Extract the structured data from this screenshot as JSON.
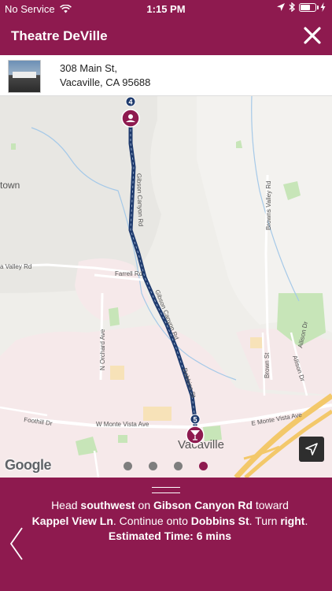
{
  "status_bar": {
    "carrier": "No Service",
    "time": "1:15 PM"
  },
  "header": {
    "title": "Theatre DeVille"
  },
  "location": {
    "address_line1": "308 Main St,",
    "address_line2": "Vacaville, CA 95688"
  },
  "map": {
    "labels": {
      "town_left": "town",
      "valley_rd": "a Valley Rd",
      "farrell_rd": "Farrell Rd",
      "n_orchard_ave": "N Orchard Ave",
      "browns_valley_rd": "Browns Valley Rd",
      "brown_st": "Brown St",
      "allison_dr": "Allison Dr",
      "foothill_dr": "Foothill Dr",
      "w_monte_vista_ave": "W Monte Vista Ave",
      "e_monte_vista_ave": "E Monte Vista Ave",
      "vacaville": "Vacaville",
      "gibson_canyon_rd": "Gibson Canyon Rd",
      "dobbins_st": "Dobbins St"
    },
    "markers": {
      "start_number": "4",
      "end_number": "5"
    },
    "attribution": "Google",
    "pager": {
      "count": 4,
      "active_index": 3
    }
  },
  "directions": {
    "prefix": "Head ",
    "heading": "southwest",
    "on": " on ",
    "road1": "Gibson Canyon Rd",
    "toward": " toward ",
    "road2": "Kappel View Ln",
    "continue": ". Continue onto ",
    "road3": "Dobbins St",
    "turn": ". Turn ",
    "turn_dir": "right",
    "end": ".",
    "estimated_label": "Estimated Time: 6 mins"
  },
  "colors": {
    "brand": "#8e1a4f",
    "route": "#1f3b6e"
  }
}
